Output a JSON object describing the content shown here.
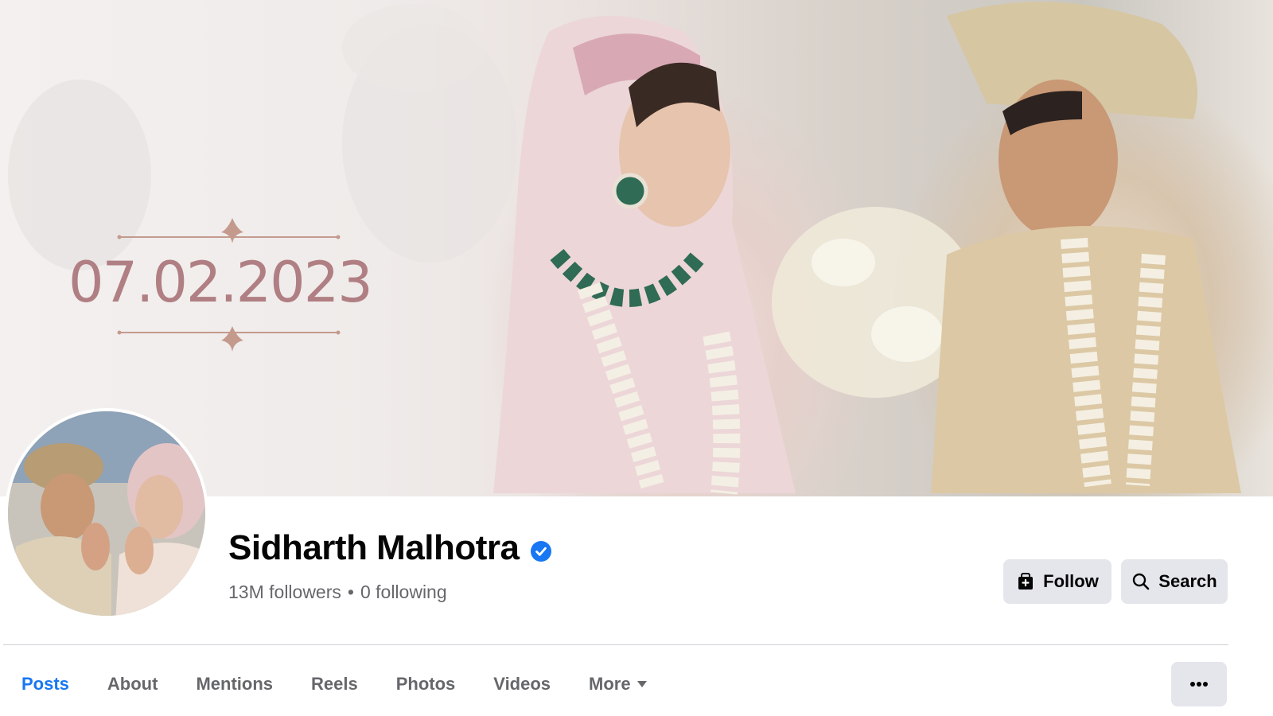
{
  "cover": {
    "date_text": "07.02.2023",
    "colors": {
      "date": "#b07f83",
      "ornament": "#c49a8d"
    }
  },
  "profile": {
    "name": "Sidharth Malhotra",
    "verified": true,
    "followers": "13M followers",
    "separator": "•",
    "following": "0 following"
  },
  "actions": {
    "follow_label": "Follow",
    "follow_icon": "follow-page-icon",
    "search_label": "Search",
    "search_icon": "search-icon",
    "more_icon": "ellipsis-icon"
  },
  "tabs": [
    {
      "label": "Posts",
      "active": true
    },
    {
      "label": "About",
      "active": false
    },
    {
      "label": "Mentions",
      "active": false
    },
    {
      "label": "Reels",
      "active": false
    },
    {
      "label": "Photos",
      "active": false
    },
    {
      "label": "Videos",
      "active": false
    },
    {
      "label": "More",
      "active": false,
      "dropdown": true
    }
  ],
  "colors": {
    "accent": "#1877f2",
    "text_primary": "#050505",
    "text_secondary": "#65676b",
    "button_bg": "#e4e6eb",
    "verified_badge": "#1877f2"
  }
}
